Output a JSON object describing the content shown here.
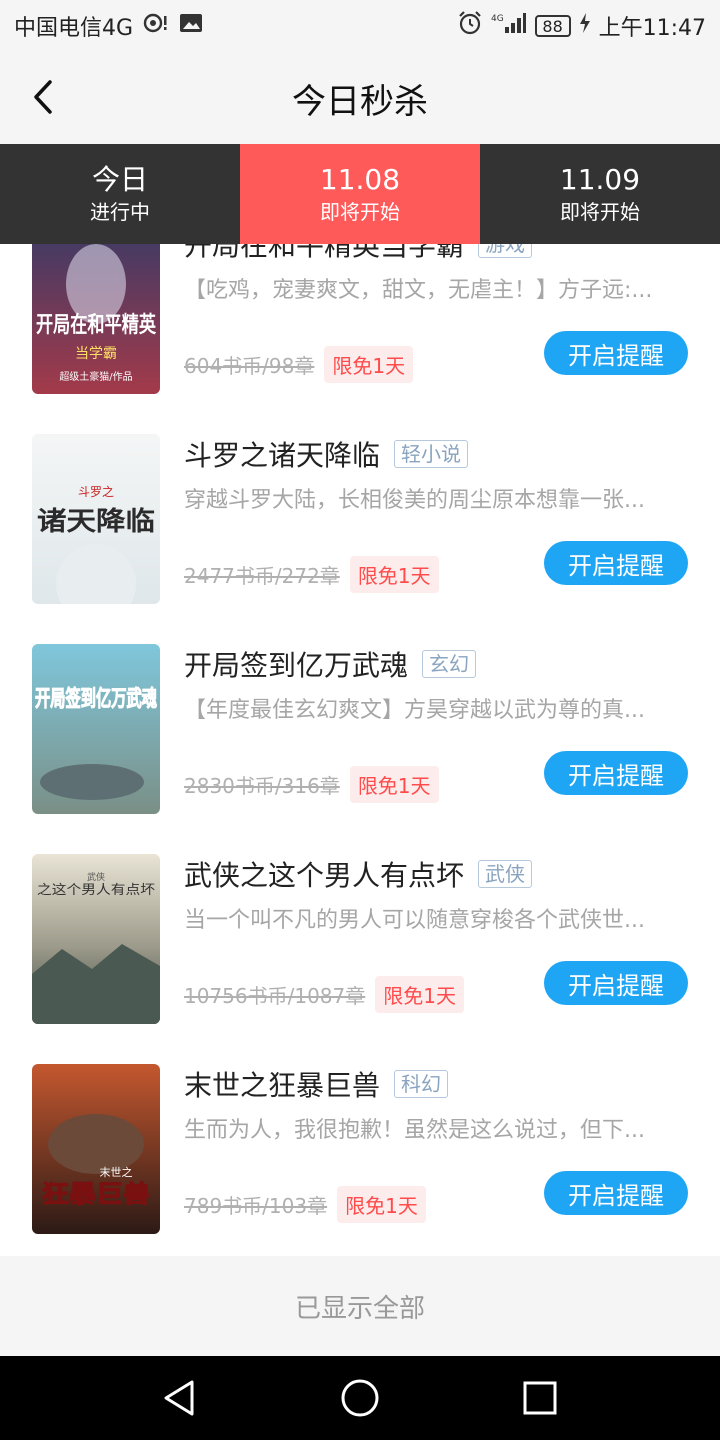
{
  "status_bar": {
    "carrier": "中国电信4G",
    "network": "4G",
    "battery": "88",
    "time": "上午11:47"
  },
  "header": {
    "title": "今日秒杀"
  },
  "tabs": [
    {
      "label": "今日",
      "sub": "进行中",
      "active": false
    },
    {
      "label": "11.08",
      "sub": "即将开始",
      "active": true
    },
    {
      "label": "11.09",
      "sub": "即将开始",
      "active": false
    }
  ],
  "books": [
    {
      "title": "开局在和平精英当学霸",
      "genre": "游戏",
      "desc": "【吃鸡，宠妻爽文，甜文，无虐主！】方子远:...",
      "price": "604书币/98章",
      "badge": "限免1天",
      "button": "开启提醒"
    },
    {
      "title": "斗罗之诸天降临",
      "genre": "轻小说",
      "desc": "穿越斗罗大陆，长相俊美的周尘原本想靠一张...",
      "price": "2477书币/272章",
      "badge": "限免1天",
      "button": "开启提醒"
    },
    {
      "title": "开局签到亿万武魂",
      "genre": "玄幻",
      "desc": "【年度最佳玄幻爽文】方昊穿越以武为尊的真...",
      "price": "2830书币/316章",
      "badge": "限免1天",
      "button": "开启提醒"
    },
    {
      "title": "武侠之这个男人有点坏",
      "genre": "武侠",
      "desc": "当一个叫不凡的男人可以随意穿梭各个武侠世...",
      "price": "10756书币/1087章",
      "badge": "限免1天",
      "button": "开启提醒"
    },
    {
      "title": "末世之狂暴巨兽",
      "genre": "科幻",
      "desc": "生而为人，我很抱歉！虽然是这么说过，但下...",
      "price": "789书币/103章",
      "badge": "限免1天",
      "button": "开启提醒"
    }
  ],
  "covers": [
    {
      "text": "开局在和平精英",
      "sub": "当学霸",
      "author": "超级土豪猫/作品",
      "bg1": "#3b3a66",
      "bg2": "#a33a4a",
      "fg": "#ffffff"
    },
    {
      "text": "诸天降临",
      "sub": "斗罗之",
      "author": "",
      "bg1": "#f4f6f6",
      "bg2": "#dfe7ea",
      "fg": "#2b2b2b"
    },
    {
      "text": "开局签到亿万武魂",
      "sub": "",
      "author": "",
      "bg1": "#7fc7dc",
      "bg2": "#7a8f86",
      "fg": "#2a47e0"
    },
    {
      "text": "之这个男人有点坏",
      "sub": "武侠",
      "author": "",
      "bg1": "#e9e4d5",
      "bg2": "#3c4a44",
      "fg": "#333333"
    },
    {
      "text": "狂暴巨兽",
      "sub": "末世之",
      "author": "",
      "bg1": "#c4582f",
      "bg2": "#2c1a16",
      "fg": "#ffdd33"
    }
  ],
  "footer": {
    "text": "已显示全部"
  },
  "colors": {
    "accent": "#ff5a5a",
    "button": "#1ea6f5",
    "tab_bg": "#333333"
  }
}
